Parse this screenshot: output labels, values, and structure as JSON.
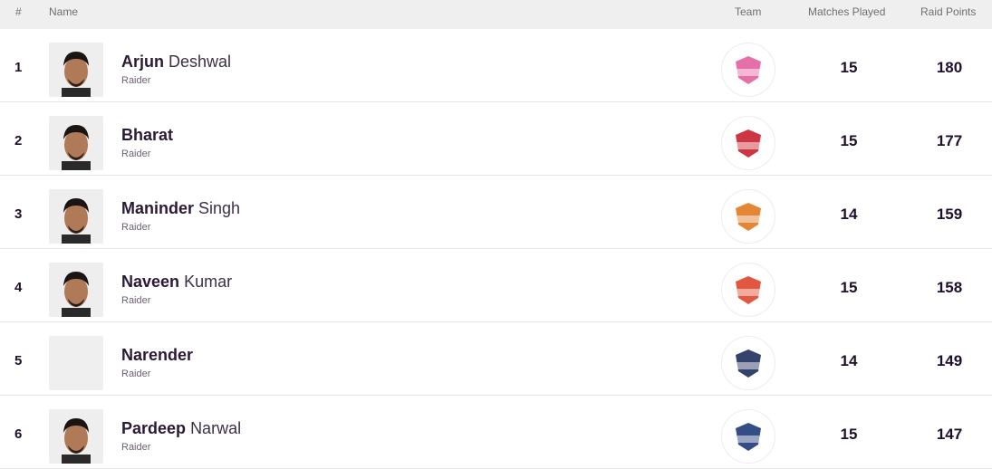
{
  "table": {
    "headers": {
      "rank": "#",
      "name": "Name",
      "team": "Team",
      "matches": "Matches Played",
      "raid_points": "Raid Points"
    },
    "rows": [
      {
        "rank": "1",
        "first_name": "Arjun",
        "last_name": "Deshwal",
        "role": "Raider",
        "team_logo": "jaipur-pink-panthers-logo",
        "team_color": "#e2609e",
        "matches": "15",
        "raid_points": "180",
        "has_photo": true
      },
      {
        "rank": "2",
        "first_name": "Bharat",
        "last_name": "",
        "role": "Raider",
        "team_logo": "bengaluru-bulls-logo",
        "team_color": "#c8202f",
        "matches": "15",
        "raid_points": "177",
        "has_photo": true
      },
      {
        "rank": "3",
        "first_name": "Maninder",
        "last_name": "Singh",
        "role": "Raider",
        "team_logo": "bengal-warriors-logo",
        "team_color": "#e07a1f",
        "matches": "14",
        "raid_points": "159",
        "has_photo": true
      },
      {
        "rank": "4",
        "first_name": "Naveen",
        "last_name": "Kumar",
        "role": "Raider",
        "team_logo": "dabang-delhi-logo",
        "team_color": "#e0442a",
        "matches": "15",
        "raid_points": "158",
        "has_photo": true
      },
      {
        "rank": "5",
        "first_name": "Narender",
        "last_name": "",
        "role": "Raider",
        "team_logo": "tamil-thalaivas-logo",
        "team_color": "#1f2d5c",
        "matches": "14",
        "raid_points": "149",
        "has_photo": false
      },
      {
        "rank": "6",
        "first_name": "Pardeep",
        "last_name": "Narwal",
        "role": "Raider",
        "team_logo": "up-yoddhas-logo",
        "team_color": "#1e3a7a",
        "matches": "15",
        "raid_points": "147",
        "has_photo": true
      }
    ]
  }
}
